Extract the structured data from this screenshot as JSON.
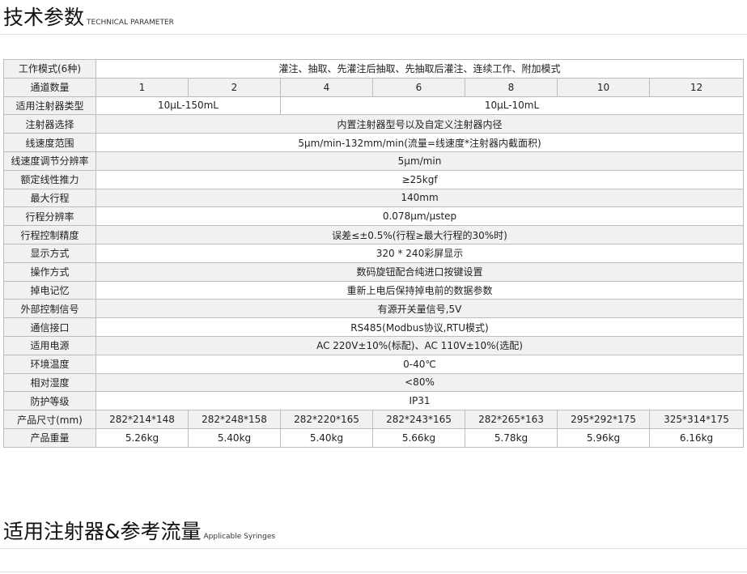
{
  "section1": {
    "title": "技术参数",
    "subtitle": "TECHNICAL PARAMETER"
  },
  "section2": {
    "title": "适用注射器&参考流量",
    "subtitle": "Applicable Syringes"
  },
  "table": {
    "mode": {
      "label": "工作模式(6种)",
      "value": "灌注、抽取、先灌注后抽取、先抽取后灌注、连续工作、附加模式"
    },
    "channels": {
      "label": "通道数量",
      "values": [
        "1",
        "2",
        "4",
        "6",
        "8",
        "10",
        "12"
      ]
    },
    "syringe_type": {
      "label": "适用注射器类型",
      "values": [
        "10μL-150mL",
        "10μL-10mL"
      ]
    },
    "full_rows": [
      {
        "label": "注射器选择",
        "value": "内置注射器型号以及自定义注射器内径"
      },
      {
        "label": "线速度范围",
        "value": "5μm/min-132mm/min(流量=线速度*注射器内截面积)"
      },
      {
        "label": "线速度调节分辨率",
        "value": "5μm/min"
      },
      {
        "label": "额定线性推力",
        "value": "≥25kgf"
      },
      {
        "label": "最大行程",
        "value": "140mm"
      },
      {
        "label": "行程分辨率",
        "value": "0.078μm/μstep"
      },
      {
        "label": "行程控制精度",
        "value": "误差≤±0.5%(行程≥最大行程的30%时)"
      },
      {
        "label": "显示方式",
        "value": "320 * 240彩屏显示"
      },
      {
        "label": "操作方式",
        "value": "数码旋钮配合纯进口按键设置"
      },
      {
        "label": "掉电记忆",
        "value": "重新上电后保持掉电前的数据参数"
      },
      {
        "label": "外部控制信号",
        "value": "有源开关量信号,5V"
      },
      {
        "label": "通信接口",
        "value": "RS485(Modbus协议,RTU模式)"
      },
      {
        "label": "适用电源",
        "value": "AC 220V±10%(标配)、AC 110V±10%(选配)"
      },
      {
        "label": "环境温度",
        "value": "0-40℃"
      },
      {
        "label": "相对湿度",
        "value": "<80%"
      },
      {
        "label": "防护等级",
        "value": "IP31"
      }
    ],
    "size": {
      "label": "产品尺寸(mm)",
      "values": [
        "282*214*148",
        "282*248*158",
        "282*220*165",
        "282*243*165",
        "282*265*163",
        "295*292*175",
        "325*314*175"
      ]
    },
    "weight": {
      "label": "产品重量",
      "values": [
        "5.26kg",
        "5.40kg",
        "5.40kg",
        "5.66kg",
        "5.78kg",
        "5.96kg",
        "6.16kg"
      ]
    }
  }
}
